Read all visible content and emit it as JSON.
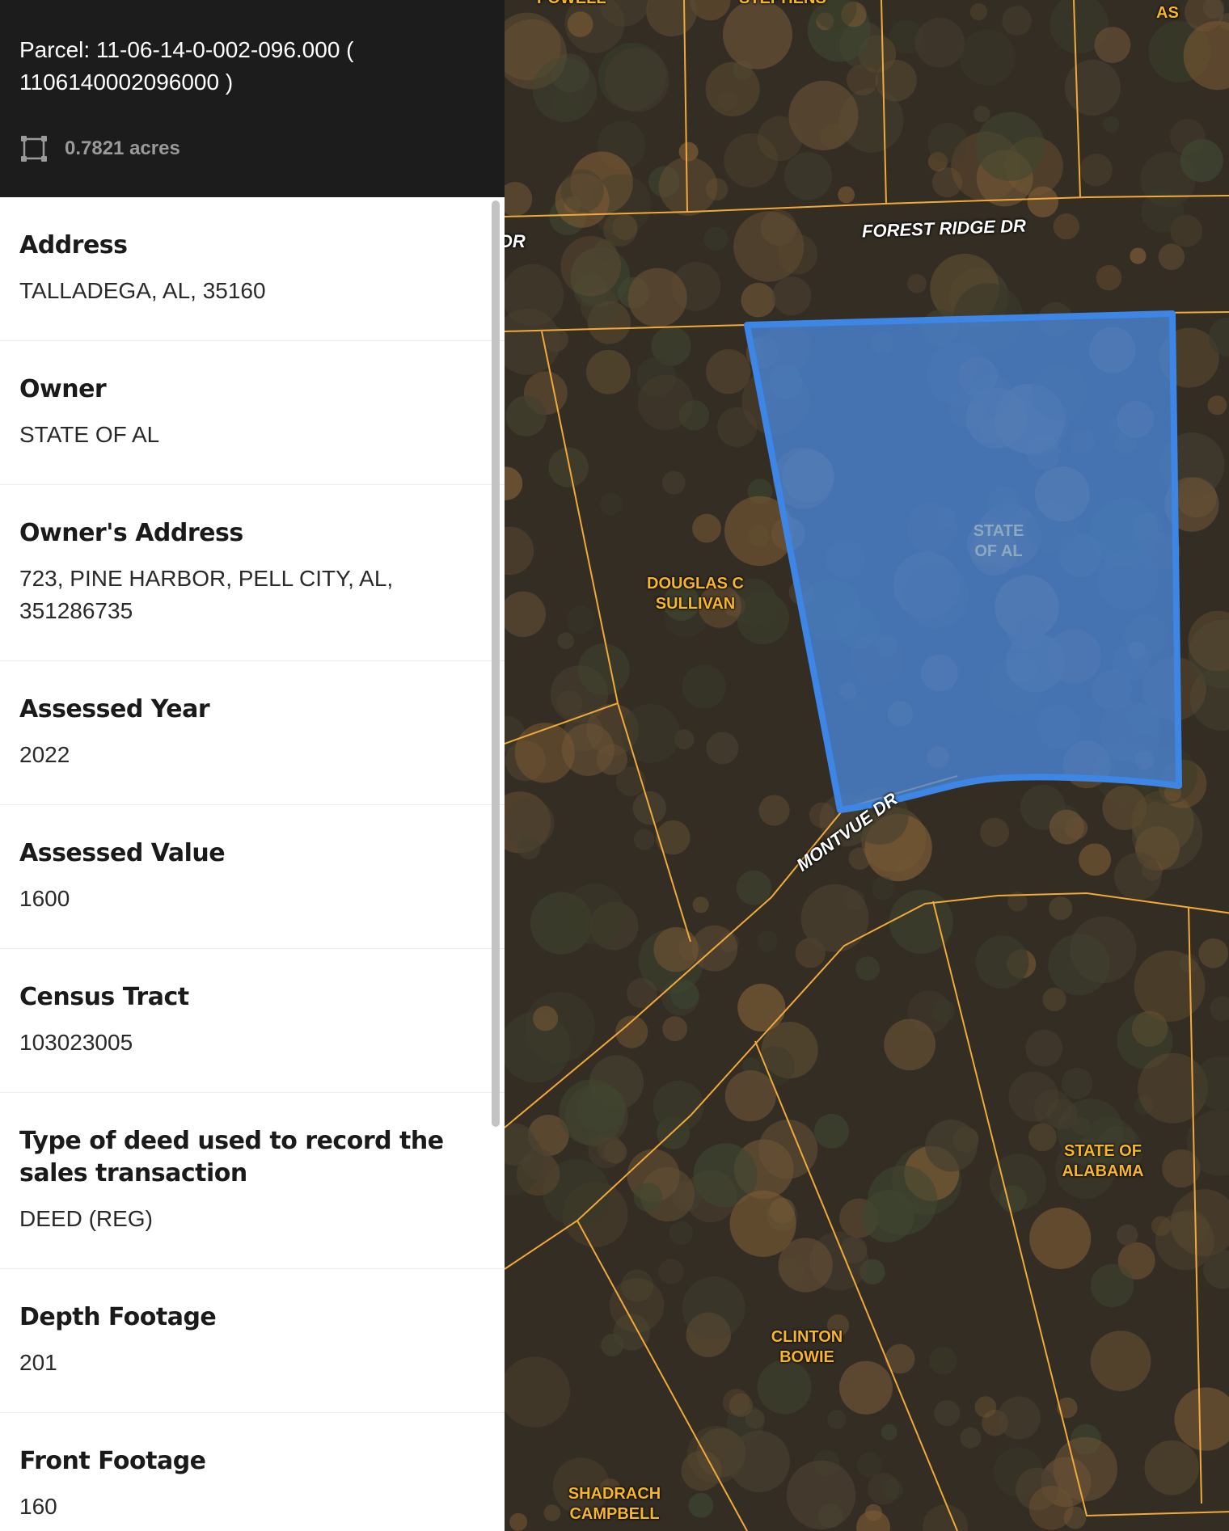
{
  "header": {
    "parcel_text": "Parcel: 11-06-14-0-002-096.000 ( 1106140002096000 )",
    "acreage": "0.7821 acres",
    "acreage_icon": "selection-area-icon"
  },
  "fields": [
    {
      "label": "Address",
      "value": "TALLADEGA, AL, 35160"
    },
    {
      "label": "Owner",
      "value": "STATE OF AL"
    },
    {
      "label": "Owner's Address",
      "value": "723, PINE HARBOR, PELL CITY, AL, 351286735"
    },
    {
      "label": "Assessed Year",
      "value": "2022"
    },
    {
      "label": "Assessed Value",
      "value": "1600"
    },
    {
      "label": "Census Tract",
      "value": "103023005"
    },
    {
      "label": "Type of deed used to record the sales transaction",
      "value": "DEED (REG)"
    },
    {
      "label": "Depth Footage",
      "value": "201"
    },
    {
      "label": "Front Footage",
      "value": "160"
    }
  ],
  "map": {
    "roads": {
      "forest_ridge": "FOREST RIDGE DR",
      "montvue": "MONTVUE DR",
      "cut_off": "DR"
    },
    "owners": {
      "top_left": "POWELL",
      "top_mid": "STEPHENS",
      "top_right": "AS",
      "selected": "STATE\nOF AL",
      "douglas": "DOUGLAS C\nSULLIVAN",
      "state_alabama": "STATE OF\nALABAMA",
      "clinton": "CLINTON\nBOWIE",
      "shadrach": "SHADRACH\nCAMPBELL"
    },
    "colors": {
      "parcel_line": "#f2a93b",
      "selected_fill": "#4a86d8",
      "selected_stroke": "#3d86e6",
      "owner_label": "#f7b52a"
    }
  }
}
